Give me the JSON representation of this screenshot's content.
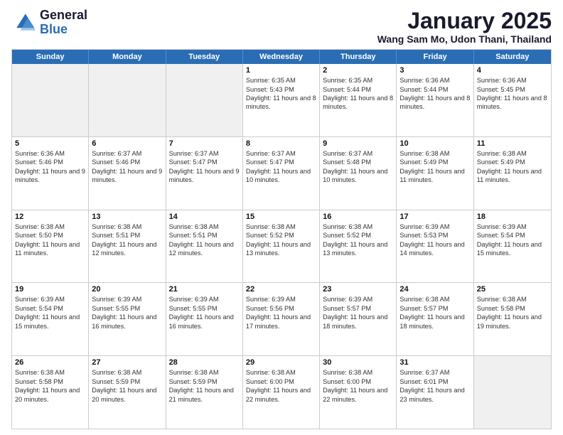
{
  "header": {
    "logo_general": "General",
    "logo_blue": "Blue",
    "month_title": "January 2025",
    "location": "Wang Sam Mo, Udon Thani, Thailand"
  },
  "weekdays": [
    "Sunday",
    "Monday",
    "Tuesday",
    "Wednesday",
    "Thursday",
    "Friday",
    "Saturday"
  ],
  "rows": [
    [
      {
        "day": "",
        "sunrise": "",
        "sunset": "",
        "daylight": "",
        "shaded": true
      },
      {
        "day": "",
        "sunrise": "",
        "sunset": "",
        "daylight": "",
        "shaded": true
      },
      {
        "day": "",
        "sunrise": "",
        "sunset": "",
        "daylight": "",
        "shaded": true
      },
      {
        "day": "1",
        "sunrise": "Sunrise: 6:35 AM",
        "sunset": "Sunset: 5:43 PM",
        "daylight": "Daylight: 11 hours and 8 minutes."
      },
      {
        "day": "2",
        "sunrise": "Sunrise: 6:35 AM",
        "sunset": "Sunset: 5:44 PM",
        "daylight": "Daylight: 11 hours and 8 minutes."
      },
      {
        "day": "3",
        "sunrise": "Sunrise: 6:36 AM",
        "sunset": "Sunset: 5:44 PM",
        "daylight": "Daylight: 11 hours and 8 minutes."
      },
      {
        "day": "4",
        "sunrise": "Sunrise: 6:36 AM",
        "sunset": "Sunset: 5:45 PM",
        "daylight": "Daylight: 11 hours and 8 minutes."
      }
    ],
    [
      {
        "day": "5",
        "sunrise": "Sunrise: 6:36 AM",
        "sunset": "Sunset: 5:46 PM",
        "daylight": "Daylight: 11 hours and 9 minutes."
      },
      {
        "day": "6",
        "sunrise": "Sunrise: 6:37 AM",
        "sunset": "Sunset: 5:46 PM",
        "daylight": "Daylight: 11 hours and 9 minutes."
      },
      {
        "day": "7",
        "sunrise": "Sunrise: 6:37 AM",
        "sunset": "Sunset: 5:47 PM",
        "daylight": "Daylight: 11 hours and 9 minutes."
      },
      {
        "day": "8",
        "sunrise": "Sunrise: 6:37 AM",
        "sunset": "Sunset: 5:47 PM",
        "daylight": "Daylight: 11 hours and 10 minutes."
      },
      {
        "day": "9",
        "sunrise": "Sunrise: 6:37 AM",
        "sunset": "Sunset: 5:48 PM",
        "daylight": "Daylight: 11 hours and 10 minutes."
      },
      {
        "day": "10",
        "sunrise": "Sunrise: 6:38 AM",
        "sunset": "Sunset: 5:49 PM",
        "daylight": "Daylight: 11 hours and 11 minutes."
      },
      {
        "day": "11",
        "sunrise": "Sunrise: 6:38 AM",
        "sunset": "Sunset: 5:49 PM",
        "daylight": "Daylight: 11 hours and 11 minutes."
      }
    ],
    [
      {
        "day": "12",
        "sunrise": "Sunrise: 6:38 AM",
        "sunset": "Sunset: 5:50 PM",
        "daylight": "Daylight: 11 hours and 11 minutes."
      },
      {
        "day": "13",
        "sunrise": "Sunrise: 6:38 AM",
        "sunset": "Sunset: 5:51 PM",
        "daylight": "Daylight: 11 hours and 12 minutes."
      },
      {
        "day": "14",
        "sunrise": "Sunrise: 6:38 AM",
        "sunset": "Sunset: 5:51 PM",
        "daylight": "Daylight: 11 hours and 12 minutes."
      },
      {
        "day": "15",
        "sunrise": "Sunrise: 6:38 AM",
        "sunset": "Sunset: 5:52 PM",
        "daylight": "Daylight: 11 hours and 13 minutes."
      },
      {
        "day": "16",
        "sunrise": "Sunrise: 6:38 AM",
        "sunset": "Sunset: 5:52 PM",
        "daylight": "Daylight: 11 hours and 13 minutes."
      },
      {
        "day": "17",
        "sunrise": "Sunrise: 6:39 AM",
        "sunset": "Sunset: 5:53 PM",
        "daylight": "Daylight: 11 hours and 14 minutes."
      },
      {
        "day": "18",
        "sunrise": "Sunrise: 6:39 AM",
        "sunset": "Sunset: 5:54 PM",
        "daylight": "Daylight: 11 hours and 15 minutes."
      }
    ],
    [
      {
        "day": "19",
        "sunrise": "Sunrise: 6:39 AM",
        "sunset": "Sunset: 5:54 PM",
        "daylight": "Daylight: 11 hours and 15 minutes."
      },
      {
        "day": "20",
        "sunrise": "Sunrise: 6:39 AM",
        "sunset": "Sunset: 5:55 PM",
        "daylight": "Daylight: 11 hours and 16 minutes."
      },
      {
        "day": "21",
        "sunrise": "Sunrise: 6:39 AM",
        "sunset": "Sunset: 5:55 PM",
        "daylight": "Daylight: 11 hours and 16 minutes."
      },
      {
        "day": "22",
        "sunrise": "Sunrise: 6:39 AM",
        "sunset": "Sunset: 5:56 PM",
        "daylight": "Daylight: 11 hours and 17 minutes."
      },
      {
        "day": "23",
        "sunrise": "Sunrise: 6:39 AM",
        "sunset": "Sunset: 5:57 PM",
        "daylight": "Daylight: 11 hours and 18 minutes."
      },
      {
        "day": "24",
        "sunrise": "Sunrise: 6:38 AM",
        "sunset": "Sunset: 5:57 PM",
        "daylight": "Daylight: 11 hours and 18 minutes."
      },
      {
        "day": "25",
        "sunrise": "Sunrise: 6:38 AM",
        "sunset": "Sunset: 5:58 PM",
        "daylight": "Daylight: 11 hours and 19 minutes."
      }
    ],
    [
      {
        "day": "26",
        "sunrise": "Sunrise: 6:38 AM",
        "sunset": "Sunset: 5:58 PM",
        "daylight": "Daylight: 11 hours and 20 minutes."
      },
      {
        "day": "27",
        "sunrise": "Sunrise: 6:38 AM",
        "sunset": "Sunset: 5:59 PM",
        "daylight": "Daylight: 11 hours and 20 minutes."
      },
      {
        "day": "28",
        "sunrise": "Sunrise: 6:38 AM",
        "sunset": "Sunset: 5:59 PM",
        "daylight": "Daylight: 11 hours and 21 minutes."
      },
      {
        "day": "29",
        "sunrise": "Sunrise: 6:38 AM",
        "sunset": "Sunset: 6:00 PM",
        "daylight": "Daylight: 11 hours and 22 minutes."
      },
      {
        "day": "30",
        "sunrise": "Sunrise: 6:38 AM",
        "sunset": "Sunset: 6:00 PM",
        "daylight": "Daylight: 11 hours and 22 minutes."
      },
      {
        "day": "31",
        "sunrise": "Sunrise: 6:37 AM",
        "sunset": "Sunset: 6:01 PM",
        "daylight": "Daylight: 11 hours and 23 minutes."
      },
      {
        "day": "",
        "sunrise": "",
        "sunset": "",
        "daylight": "",
        "shaded": true
      }
    ]
  ]
}
